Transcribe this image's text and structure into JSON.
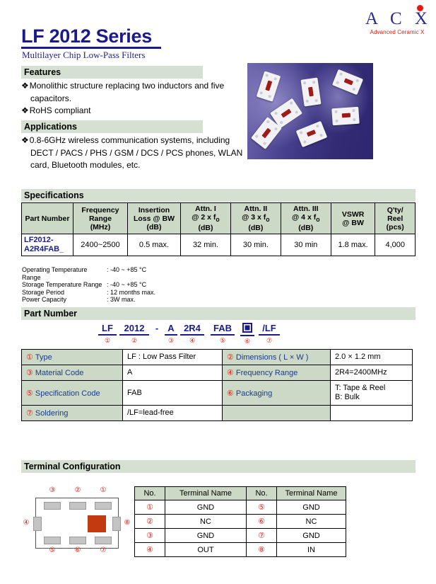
{
  "header": {
    "title": "LF 2012 Series",
    "subtitle": "Multilayer Chip Low-Pass Filters",
    "logo_letters": "A C X",
    "logo_tagline": "Advanced Ceramic X"
  },
  "sections": {
    "features": "Features",
    "applications": "Applications",
    "specifications": "Specifications",
    "part_number": "Part Number",
    "terminal_configuration": "Terminal Configuration"
  },
  "features": {
    "items": [
      {
        "line1": "Monolithic structure replacing two inductors and five",
        "line2": "capacitors."
      },
      {
        "line1": "RoHS compliant",
        "line2": ""
      }
    ]
  },
  "applications": {
    "items": [
      {
        "line1": "0.8-6GHz wireless communication systems, including",
        "line2": "DECT / PACS / PHS / GSM / DCS / PCS phones, WLAN",
        "line3": "card, Bluetooth modules, etc."
      }
    ]
  },
  "spec_table": {
    "headers": [
      "Part Number",
      "Frequency Range (MHz)",
      "Insertion Loss @ BW (dB)",
      "Attn. I @ 2 x fₒ (dB)",
      "Attn. II @ 3 x fₒ (dB)",
      "Attn. III @ 4 x fₒ (dB)",
      "VSWR @ BW",
      "Q'ty/ Reel (pcs)"
    ],
    "header_parts": {
      "part_number": "Part Number",
      "freq_l1": "Frequency",
      "freq_l2": "Range",
      "freq_l3": "(MHz)",
      "il_l1": "Insertion",
      "il_l2": "Loss @ BW",
      "il_l3": "(dB)",
      "a1_l1": "Attn. I",
      "a1_l2": "@ 2 x f",
      "a1_sub": "o",
      "a1_l3": "(dB)",
      "a2_l1": "Attn. II",
      "a2_l2": "@ 3 x f",
      "a2_sub": "o",
      "a2_l3": "(dB)",
      "a3_l1": "Attn. III",
      "a3_l2": "@ 4 x f",
      "a3_sub": "o",
      "a3_l3": "(dB)",
      "vswr_l1": "VSWR",
      "vswr_l2": "@ BW",
      "qty_l1": "Q'ty/",
      "qty_l2": "Reel",
      "qty_l3": "(pcs)"
    },
    "rows": [
      {
        "part_number_l1": "LF2012-",
        "part_number_l2": "A2R4FAB_",
        "frequency_range": "2400~2500",
        "insertion_loss": "0.5 max.",
        "attn1": "32 min.",
        "attn2": "30 min.",
        "attn3": "30 min",
        "vswr": "1.8 max.",
        "qty_reel": "4,000"
      }
    ]
  },
  "ratings": [
    {
      "key": "Operating Temperature Range",
      "value": ": -40 ~ +85 °C"
    },
    {
      "key": "Storage Temperature Range",
      "value": ": -40 ~ +85 °C"
    },
    {
      "key": "Storage Period",
      "value": ": 12 months max."
    },
    {
      "key": "Power Capacity",
      "value": ": 3W max."
    }
  ],
  "part_code": {
    "segments": [
      {
        "text": "LF",
        "num": "①"
      },
      {
        "text": "2012",
        "num": "②"
      },
      {
        "text": "-",
        "num": ""
      },
      {
        "text": "A",
        "num": "③"
      },
      {
        "text": "2R4",
        "num": "④"
      },
      {
        "text": "FAB",
        "num": "⑤"
      },
      {
        "text": "",
        "num": "⑥"
      },
      {
        "text": "/LF",
        "num": "⑦"
      }
    ]
  },
  "pn_table": {
    "rows": [
      {
        "l_num": "①",
        "l_label": "Type",
        "l_value": "LF : Low Pass Filter",
        "r_num": "②",
        "r_label": "Dimensions ( L × W )",
        "r_value": "2.0 × 1.2 mm"
      },
      {
        "l_num": "③",
        "l_label": "Material Code",
        "l_value": "A",
        "r_num": "④",
        "r_label": "Frequency Range",
        "r_value": "2R4=2400MHz"
      },
      {
        "l_num": "⑤",
        "l_label": "Specification Code",
        "l_value": "FAB",
        "r_num": "⑥",
        "r_label": "Packaging",
        "r_value_l1": "T: Tape & Reel",
        "r_value_l2": "B: Bulk"
      },
      {
        "l_num": "⑦",
        "l_label": "Soldering",
        "l_value": "/LF=lead-free",
        "r_num": "",
        "r_label": "",
        "r_value": ""
      }
    ]
  },
  "terminal_table": {
    "headers": {
      "no": "No.",
      "name": "Terminal Name",
      "no2": "No.",
      "name2": "Terminal Name"
    },
    "rows": [
      {
        "no": "①",
        "name": "GND",
        "no2": "⑤",
        "name2": "GND"
      },
      {
        "no": "②",
        "name": "NC",
        "no2": "⑥",
        "name2": "NC"
      },
      {
        "no": "③",
        "name": "GND",
        "no2": "⑦",
        "name2": "GND"
      },
      {
        "no": "④",
        "name": "OUT",
        "no2": "⑧",
        "name2": "IN"
      }
    ]
  },
  "terminal_diagram": {
    "numbers": {
      "n1": "①",
      "n2": "②",
      "n3": "③",
      "n4": "④",
      "n5": "⑤",
      "n6": "⑥",
      "n7": "⑦",
      "n8": "⑧"
    }
  },
  "colors": {
    "brand_blue": "#1a1a8c",
    "brand_red": "#e8180c",
    "section_bar": "#d5dfd2",
    "table_header": "#ccd9c7",
    "terminal_marker": "#c43a10"
  }
}
